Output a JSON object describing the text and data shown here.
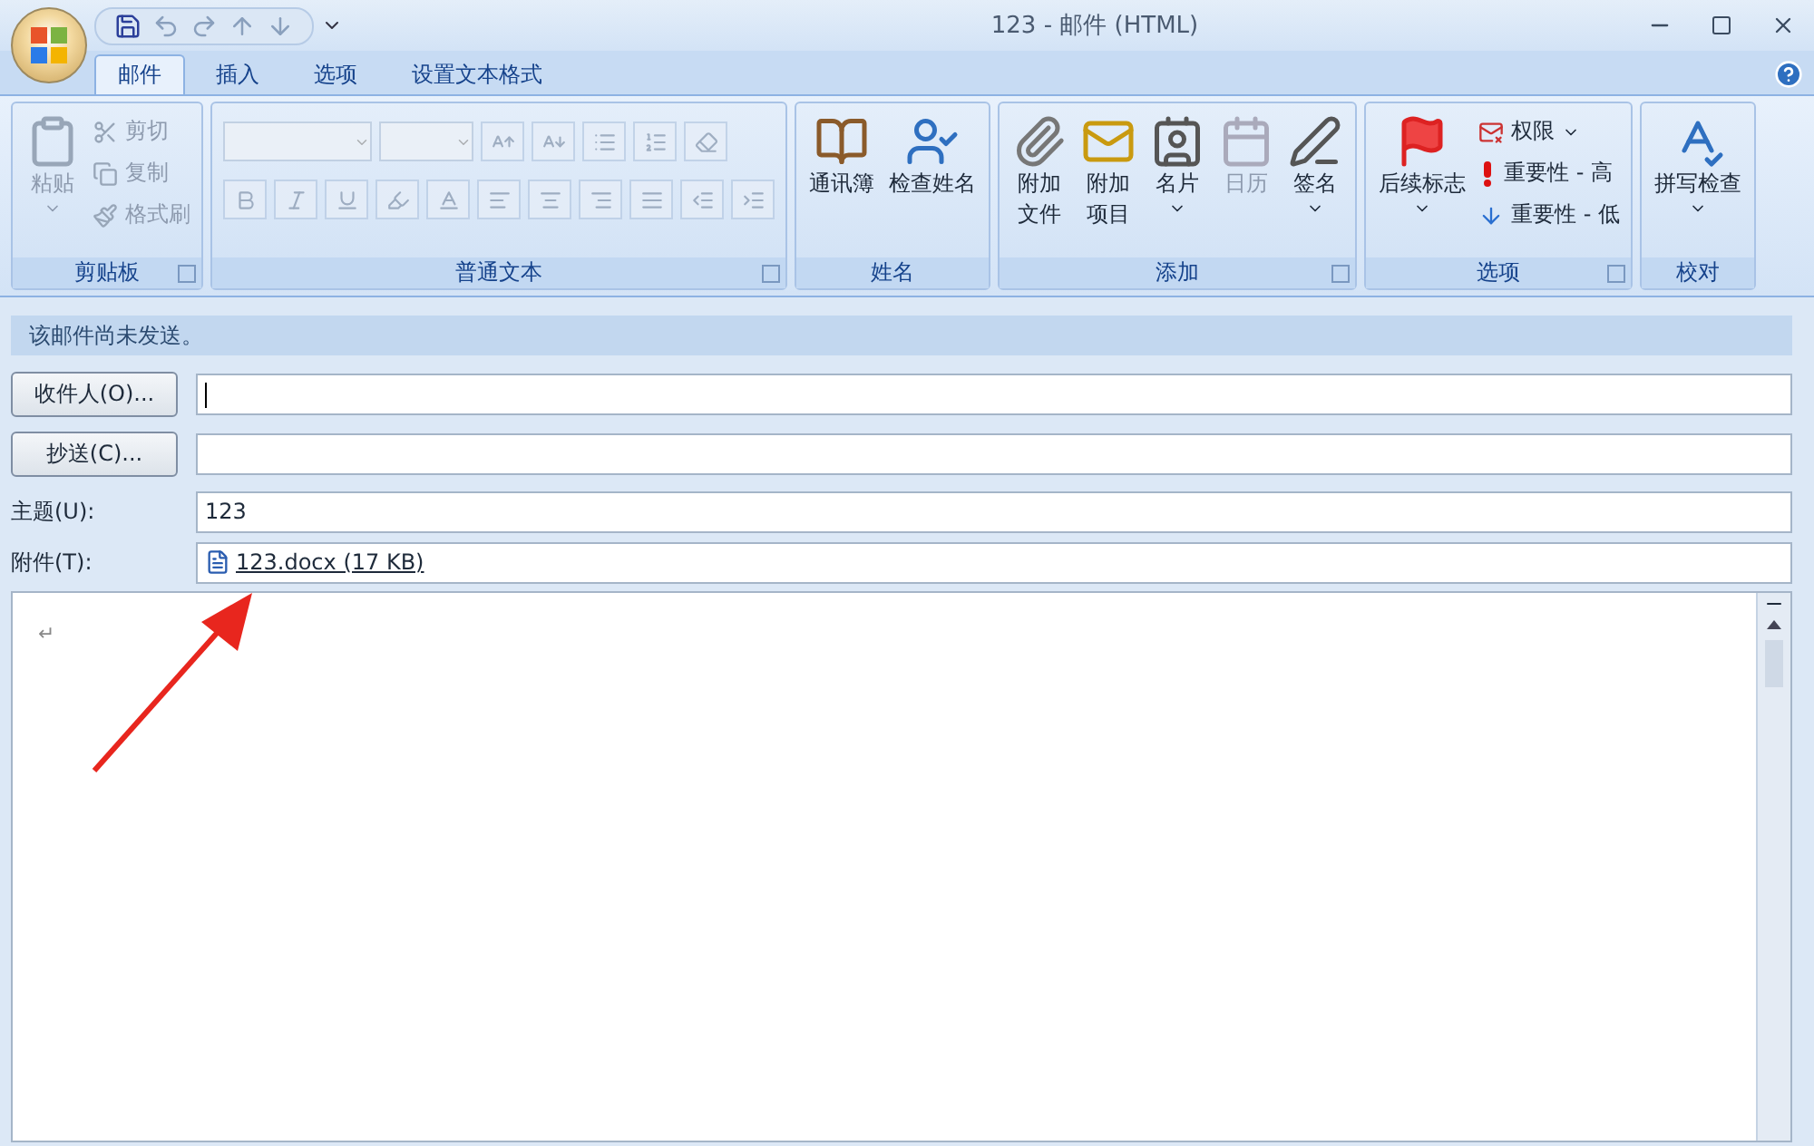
{
  "window": {
    "title": "123 - 邮件 (HTML)"
  },
  "tabs": [
    {
      "label": "邮件",
      "selected": true
    },
    {
      "label": "插入",
      "selected": false
    },
    {
      "label": "选项",
      "selected": false
    },
    {
      "label": "设置文本格式",
      "selected": false
    }
  ],
  "ribbon": [
    {
      "label": "剪贴板",
      "items": [
        {
          "kind": "large",
          "label": [
            "粘贴"
          ],
          "disabled": true,
          "dropdown": true
        },
        {
          "kind": "small",
          "label": "剪切",
          "disabled": true,
          "dropdown": false
        },
        {
          "kind": "small",
          "label": "复制",
          "disabled": true,
          "dropdown": false
        },
        {
          "kind": "small",
          "label": "格式刷",
          "disabled": true,
          "dropdown": false
        }
      ]
    },
    {
      "label": "普通文本",
      "items": [
        {
          "kind": "format",
          "disabled": true
        }
      ]
    },
    {
      "label": "姓名",
      "items": [
        {
          "kind": "large",
          "label": [
            "通讯簿"
          ],
          "disabled": false,
          "dropdown": false
        },
        {
          "kind": "large",
          "label": [
            "检查姓名"
          ],
          "disabled": false,
          "dropdown": false
        }
      ]
    },
    {
      "label": "添加",
      "items": [
        {
          "kind": "large",
          "label": [
            "附加",
            "文件"
          ],
          "disabled": false,
          "dropdown": false
        },
        {
          "kind": "large",
          "label": [
            "附加",
            "项目"
          ],
          "disabled": false,
          "dropdown": false
        },
        {
          "kind": "large",
          "label": [
            "名片"
          ],
          "disabled": false,
          "dropdown": true
        },
        {
          "kind": "large",
          "label": [
            "日历"
          ],
          "disabled": true,
          "dropdown": false
        },
        {
          "kind": "large",
          "label": [
            "签名"
          ],
          "disabled": false,
          "dropdown": true
        }
      ]
    },
    {
      "label": "选项",
      "items": [
        {
          "kind": "large",
          "label": [
            "后续标志"
          ],
          "disabled": false,
          "dropdown": true
        },
        {
          "kind": "small",
          "label": "权限",
          "disabled": false,
          "dropdown": true
        },
        {
          "kind": "small",
          "label": "重要性 - 高",
          "disabled": false,
          "dropdown": false
        },
        {
          "kind": "small",
          "label": "重要性 - 低",
          "disabled": false,
          "dropdown": false
        }
      ]
    },
    {
      "label": "校对",
      "items": [
        {
          "kind": "large",
          "label": [
            "拼写检查"
          ],
          "disabled": false,
          "dropdown": true
        }
      ]
    }
  ],
  "message_bar": "该邮件尚未发送。",
  "recipients": [
    {
      "button": "收件人(O)...",
      "focused": true
    },
    {
      "button": "抄送(C)...",
      "focused": false
    }
  ],
  "subject": {
    "label": "主题(U):",
    "value": "123"
  },
  "attachment": {
    "label": "附件(T):",
    "file": "123.docx (17 KB)"
  },
  "body": {
    "text": "↵"
  }
}
